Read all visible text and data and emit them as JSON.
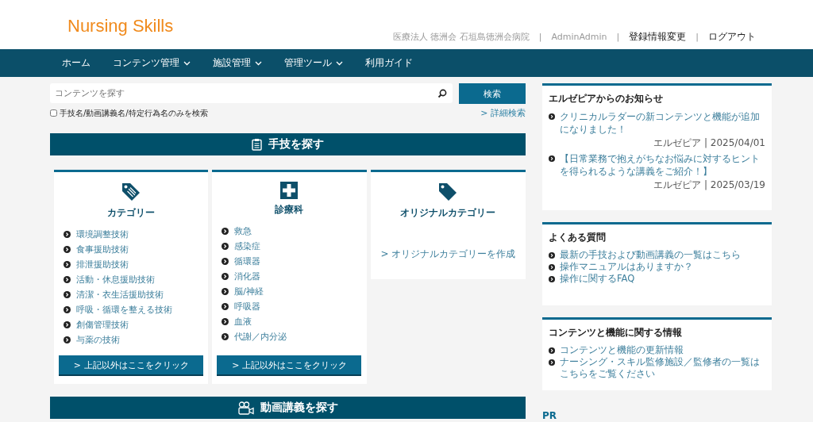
{
  "header": {
    "logo": "Nursing Skills",
    "separator": "|",
    "user_links": [
      {
        "kind": "text",
        "label": "医療法人 徳洲会 石垣島徳洲会病院"
      },
      {
        "kind": "text",
        "label": "AdminAdmin"
      },
      {
        "kind": "link",
        "label": "登録情報変更"
      },
      {
        "kind": "link",
        "label": "ログアウト"
      }
    ]
  },
  "nav": [
    {
      "label": "ホーム",
      "dropdown": false
    },
    {
      "label": "コンテンツ管理",
      "dropdown": true
    },
    {
      "label": "施設管理",
      "dropdown": true
    },
    {
      "label": "管理ツール",
      "dropdown": true
    },
    {
      "label": "利用ガイド",
      "dropdown": false
    }
  ],
  "search": {
    "placeholder": "コンテンツを探す",
    "button": "検索",
    "checkbox": {
      "label": "手技名/動画講義名/特定行為名のみを検索",
      "checked": false
    },
    "advanced_link": "> 詳細検索"
  },
  "skills_section": {
    "title": "手技を探す",
    "cards": [
      {
        "kind": "tags",
        "title": "カテゴリー",
        "items": [
          "環境調整技術",
          "食事援助技術",
          "排泄援助技術",
          "活動・休息援助技術",
          "清潔・衣生活援助技術",
          "呼吸・循環を整える技術",
          "創傷管理技術",
          "与薬の技術"
        ],
        "button": "> 上記以外はここをクリック"
      },
      {
        "kind": "cross",
        "title": "診療科",
        "items": [
          "救急",
          "感染症",
          "循環器",
          "消化器",
          "脳/神経",
          "呼吸器",
          "血液",
          "代謝／内分泌"
        ],
        "button": "> 上記以外はここをクリック"
      },
      {
        "kind": "tag",
        "title": "オリジナルカテゴリー",
        "link": "> オリジナルカテゴリーを作成"
      }
    ]
  },
  "video_section": {
    "title": "動画講義を探す"
  },
  "sidebar": [
    {
      "title": "エルゼピアからのお知らせ",
      "news": [
        {
          "text": "クリニカルラダーの新コンテンツと機能が追加になりました！",
          "meta": "エルゼピア | 2025/04/01"
        },
        {
          "text": "【日常業務で抱えがちなお悩みに対するヒントを得られるような講義をご紹介！】",
          "meta": "エルゼピア | 2025/03/19"
        }
      ]
    },
    {
      "title": "よくある質問",
      "links": [
        "最新の手技および動画講義の一覧はこちら",
        "操作マニュアルはありますか？",
        "操作に関するFAQ"
      ]
    },
    {
      "title": "コンテンツと機能に関する情報",
      "links": [
        "コンテンツと機能の更新情報",
        "ナーシング・スキル監修施設／監修者の一覧はこちらをご覧ください"
      ]
    }
  ],
  "pr_heading": "PR"
}
